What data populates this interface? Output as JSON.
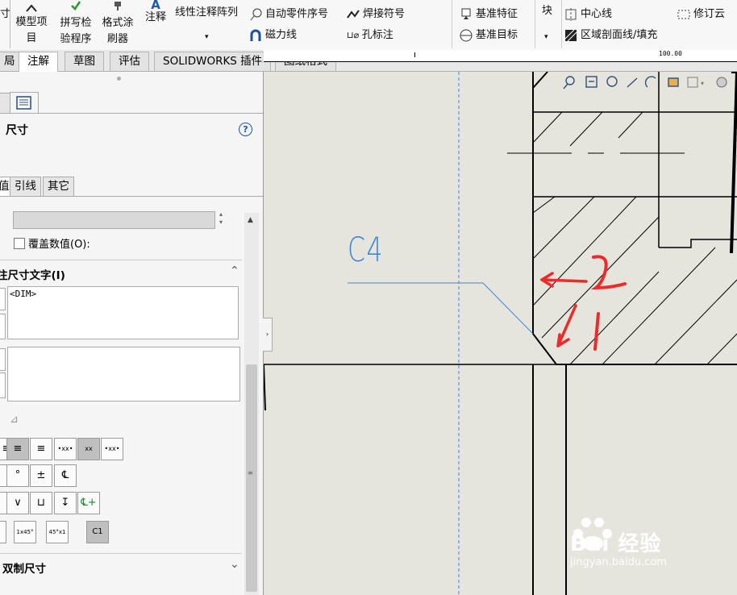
{
  "ribbon": {
    "col0_label": "寸",
    "model_items": "模型项\n目",
    "spell_check": "拼写检\n验程序",
    "format_painter": "格式涂\n刷器",
    "note": "注释",
    "linear_note_array": "线性注释阵列",
    "auto_balloon": "自动零件序号",
    "magnetic_line": "磁力线",
    "weld_symbol": "焊接符号",
    "hole_callout": "孔标注",
    "datum_feature": "基准特征",
    "datum_target": "基准目标",
    "block": "块",
    "centerline": "中心线",
    "area_hatch": "区域剖面线/填充",
    "revision_cloud": "修订云"
  },
  "tabs": [
    "局",
    "注解",
    "草图",
    "评估",
    "SOLIDWORKS 插件",
    "图纸格式"
  ],
  "active_tab": 1,
  "ruler": {
    "mark": "100.00"
  },
  "panel": {
    "title": "尺寸",
    "help": "?",
    "subtabs": [
      "值",
      "引线",
      "其它"
    ],
    "override_value_label": "覆盖数值(O):",
    "dim_text_section": "注尺寸文字(I)",
    "dim_text_value": "<DIM>",
    "align_buttons": [
      "≡",
      "≡",
      "≡"
    ],
    "symbol_row1": [
      "°",
      "±",
      "℄"
    ],
    "symbol_row2": [
      "∨",
      "⊔",
      "↧",
      "℄+"
    ],
    "chamfer_buttons": [
      "1x45°",
      "45°x1",
      "C1"
    ],
    "dual_dim": "双制尺寸"
  },
  "canvas": {
    "annotation_text": "C4",
    "red_number_1": "2",
    "red_number_2": "1"
  },
  "watermark": "Bai 经验",
  "watermark_url": "jingyan.baidu.com",
  "colors": {
    "ribbon_bg": "#f7f7f7",
    "canvas_bg": "#e6e5dd",
    "annotation_blue": "#3a86d8",
    "red_mark": "#ee2a2a"
  }
}
